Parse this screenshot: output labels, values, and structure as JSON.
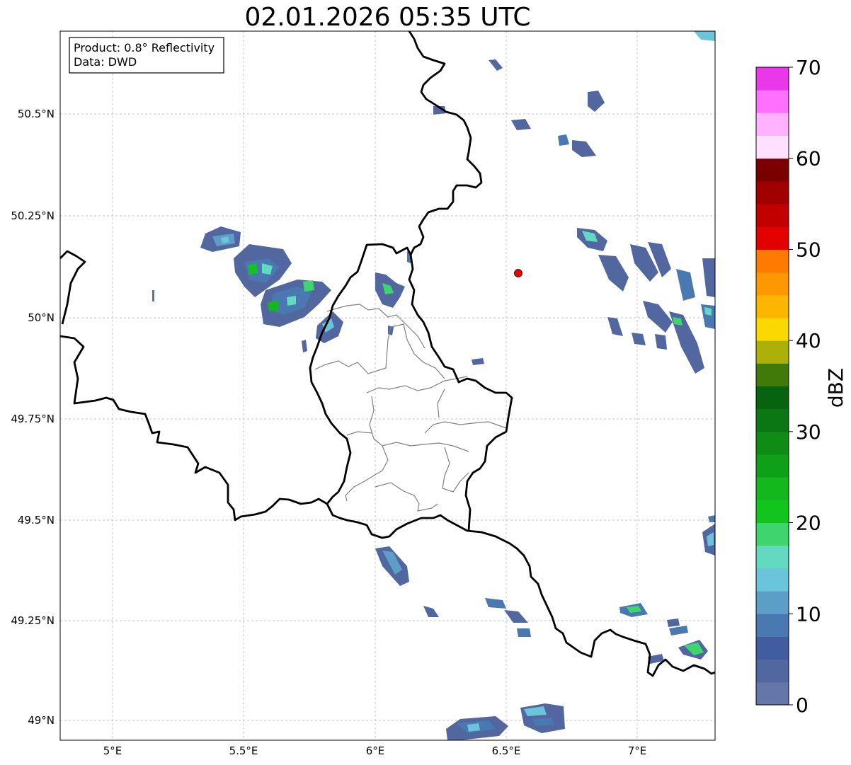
{
  "title": "02.01.2026 05:35 UTC",
  "info_box": {
    "product": "Product: 0.8° Reflectivity",
    "data": "Data: DWD"
  },
  "axes": {
    "lon_ticks": [
      "5°E",
      "5.5°E",
      "6°E",
      "6.5°E",
      "7°E"
    ],
    "lat_ticks": [
      "49°N",
      "49.25°N",
      "49.5°N",
      "49.75°N",
      "50°N",
      "50.25°N",
      "50.5°N"
    ]
  },
  "colorbar": {
    "label": "dBZ",
    "ticks": [
      "0",
      "10",
      "20",
      "30",
      "40",
      "50",
      "60",
      "70"
    ],
    "min": 0,
    "max": 70,
    "step": 2.5,
    "colors": [
      "#6577a8",
      "#52679f",
      "#415c9f",
      "#4a78b0",
      "#5d9ec6",
      "#6ac4da",
      "#62d9c0",
      "#3ed46e",
      "#12c41d",
      "#12b81e",
      "#0ea019",
      "#0f8b16",
      "#0b7714",
      "#08630e",
      "#427a0a",
      "#aeb00a",
      "#fad800",
      "#fdb600",
      "#ff9800",
      "#ff7b00",
      "#e20000",
      "#c20000",
      "#a00000",
      "#7a0000",
      "#ffe0ff",
      "#ffb2ff",
      "#ff70ff",
      "#ea37ea"
    ]
  },
  "marker": {
    "label": "radar site",
    "color": "#ee0000"
  },
  "map_colors": {
    "border": "#000000",
    "admin": "#808080",
    "grid": "#b0b0b0"
  }
}
